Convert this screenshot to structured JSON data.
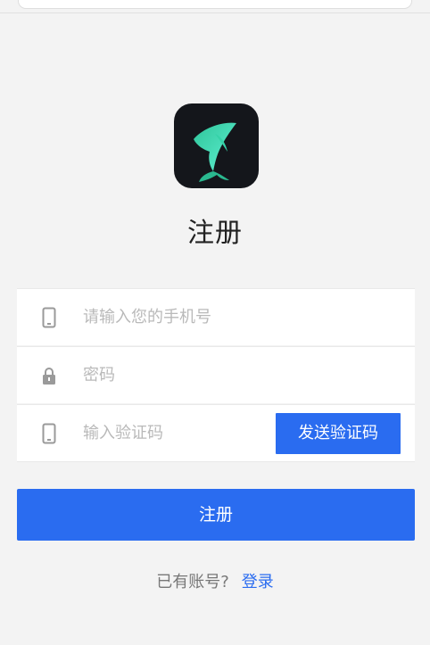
{
  "page": {
    "title": "注册"
  },
  "icons": {
    "logo": "fish-logo-icon",
    "phone": "phone-icon",
    "lock": "lock-icon"
  },
  "form": {
    "phone_placeholder": "请输入您的手机号",
    "password_placeholder": "密码",
    "code_placeholder": "输入验证码",
    "send_code_label": "发送验证码"
  },
  "submit_label": "注册",
  "footer": {
    "question": "已有账号?",
    "login_link": "登录"
  },
  "colors": {
    "accent": "#2a6cf0",
    "background": "#f3f3f3",
    "logo_bg": "#14161b",
    "logo_fish": "#3fd9b4"
  }
}
